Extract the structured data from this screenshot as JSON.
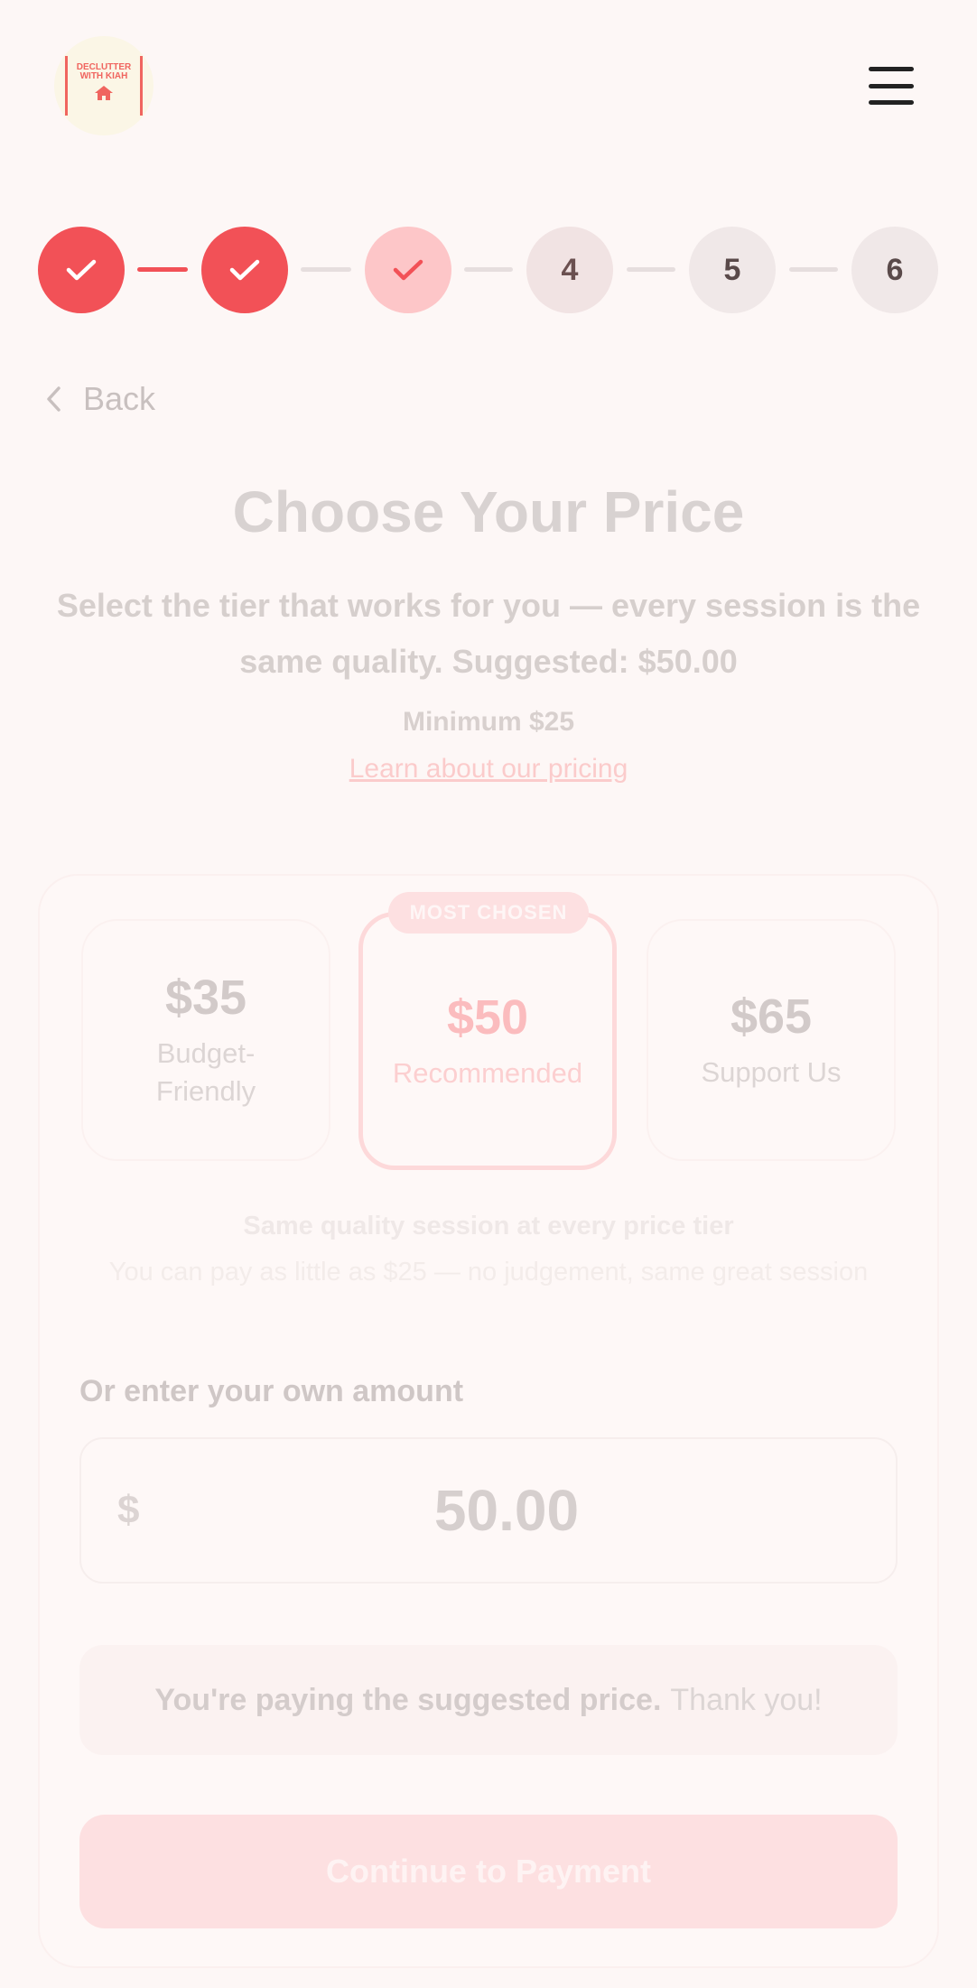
{
  "header": {
    "logo_text": "DECLUTTER WITH KIAH",
    "logo_icon": "house-icon",
    "menu_icon": "hamburger-menu-icon"
  },
  "stepper": {
    "steps": [
      {
        "label": "",
        "state": "done"
      },
      {
        "label": "",
        "state": "done"
      },
      {
        "label": "",
        "state": "current"
      },
      {
        "label": "4",
        "state": "todo"
      },
      {
        "label": "5",
        "state": "todo"
      },
      {
        "label": "6",
        "state": "todo"
      }
    ]
  },
  "nav": {
    "back_label": "Back"
  },
  "heading": {
    "title": "Choose Your Price",
    "subtitle": "Select the tier that works for you — every session is the same quality. Suggested: $50.00",
    "minimum": "Minimum $25",
    "learn_link": "Learn about our pricing"
  },
  "tiers": [
    {
      "price": "$35",
      "label": "Budget-Friendly"
    },
    {
      "price": "$50",
      "label": "Recommended",
      "badge": "MOST CHOSEN"
    },
    {
      "price": "$65",
      "label": "Support Us"
    }
  ],
  "info": {
    "same_quality": "Same quality session at every price tier",
    "pay_little": "You can pay as little as $25 — no judgement, same great session"
  },
  "custom_amount": {
    "label": "Or enter your own amount",
    "currency": "$",
    "value": "50.00"
  },
  "note": {
    "strong": "You're paying the suggested price.",
    "soft": "Thank you!"
  },
  "actions": {
    "continue_label": "Continue to Payment"
  },
  "colors": {
    "accent": "#f25157",
    "accent_light": "#fdc6c8",
    "background": "#fdf7f6"
  }
}
